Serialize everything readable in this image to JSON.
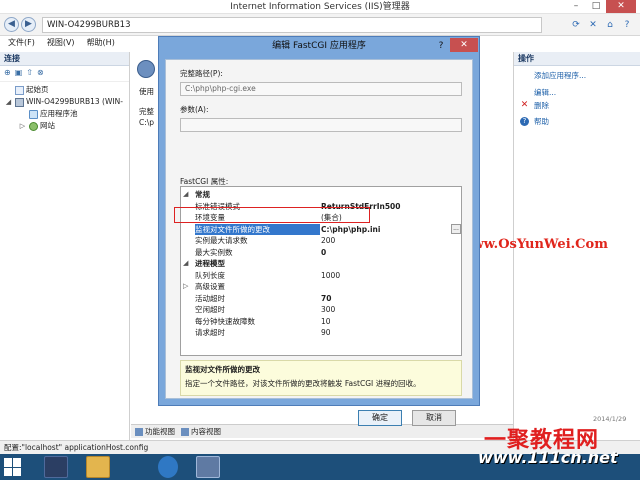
{
  "window": {
    "title": "Internet Information Services (IIS)管理器"
  },
  "address": {
    "path": "WIN-O4299BURB13"
  },
  "menu": [
    "文件(F)",
    "视图(V)",
    "帮助(H)"
  ],
  "connections": {
    "header": "连接",
    "tree": [
      {
        "label": "起始页",
        "indent": 0,
        "icon": "page-icon"
      },
      {
        "label": "WIN-O4299BURB13 (WIN-",
        "indent": 0,
        "icon": "server-icon"
      },
      {
        "label": "应用程序池",
        "indent": 1,
        "icon": "pool-icon"
      },
      {
        "label": "网站",
        "indent": 1,
        "icon": "sites-icon"
      }
    ]
  },
  "center": {
    "text1": "使用",
    "text2": "完整",
    "text3": "C:\\p"
  },
  "bottom_tabs": {
    "features": "功能视图",
    "content": "内容视图"
  },
  "actions": {
    "header": "操作",
    "items": [
      {
        "label": "添加应用程序...",
        "icon": ""
      },
      {
        "label": "编辑...",
        "icon": ""
      },
      {
        "label": "删除",
        "icon": "delete-icon"
      },
      {
        "label": "帮助",
        "icon": "help-icon"
      }
    ]
  },
  "status": {
    "text": "配置:\"localhost\" applicationHost.config"
  },
  "taskbar": {
    "date": "2014/1/29"
  },
  "dialog": {
    "title": "编辑 FastCGI 应用程序",
    "help_glyph": "?",
    "close_glyph": "✕",
    "full_path_label": "完整路径(P):",
    "full_path_value": "C:\\php\\php-cgi.exe",
    "args_label": "参数(A):",
    "args_value": "",
    "props_label": "FastCGI 属性:",
    "properties": [
      {
        "type": "cat",
        "name": "常规",
        "value": "",
        "marker": "◢"
      },
      {
        "type": "row",
        "name": "标准错误模式",
        "value": "ReturnStdErrIn500",
        "bold": true
      },
      {
        "type": "row",
        "name": "环境变量",
        "value": "(集合)",
        "bold": false
      },
      {
        "type": "row",
        "name": "监视对文件所做的更改",
        "value": "C:\\php\\php.ini",
        "bold": true,
        "selected": true
      },
      {
        "type": "row",
        "name": "实例最大请求数",
        "value": "200",
        "bold": false
      },
      {
        "type": "row",
        "name": "最大实例数",
        "value": "0",
        "bold": true
      },
      {
        "type": "cat",
        "name": "进程模型",
        "value": "",
        "marker": "◢"
      },
      {
        "type": "row",
        "name": "队列长度",
        "value": "1000",
        "bold": false
      },
      {
        "type": "row",
        "name": "高级设置",
        "value": "",
        "marker": "▷"
      },
      {
        "type": "row",
        "name": "活动超时",
        "value": "70",
        "bold": true
      },
      {
        "type": "row",
        "name": "空闲超时",
        "value": "300",
        "bold": false
      },
      {
        "type": "row",
        "name": "每分钟快速故障数",
        "value": "10",
        "bold": false
      },
      {
        "type": "row",
        "name": "请求超时",
        "value": "90",
        "bold": false
      }
    ],
    "desc_title": "监视对文件所做的更改",
    "desc_text": "指定一个文件路径，对该文件所做的更改将触发 FastCGI 进程的回收。",
    "ok_label": "确定",
    "cancel_label": "取消"
  },
  "watermarks": {
    "url": "Www.OsYunWei.Com",
    "brand": "一聚教程网",
    "site": "www.111cn.net"
  },
  "colors": {
    "dialog_frame": "#7aa7db",
    "selection": "#3377cc",
    "highlight_box": "#dd2222",
    "watermark_red": "#e0251b",
    "taskbar": "#1d4f7a"
  }
}
